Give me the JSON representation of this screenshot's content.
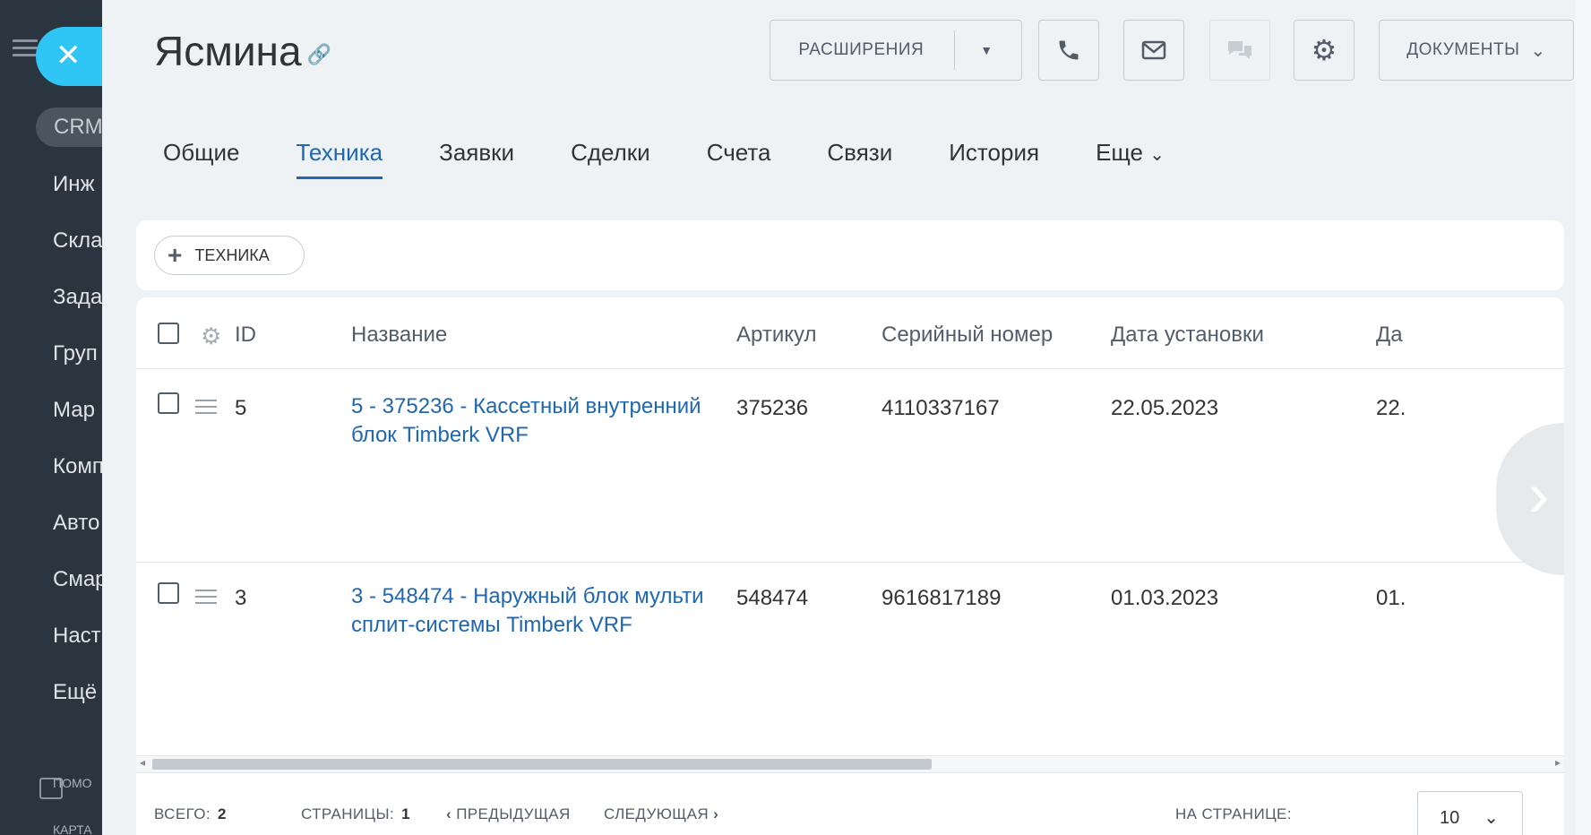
{
  "sidebar": {
    "crm_label": "CRM",
    "items": [
      "Инж",
      "Скла",
      "Зада",
      "Груп",
      "Мар",
      "Комп",
      "Авто",
      "Смар",
      "Наст",
      "Ещё"
    ],
    "help_label": "ПОМО",
    "map_label": "КАРТА"
  },
  "header": {
    "title": "Ясмина",
    "extensions_label": "РАСШИРЕНИЯ",
    "documents_label": "ДОКУМЕНТЫ"
  },
  "tabs": [
    {
      "label": "Общие",
      "active": false
    },
    {
      "label": "Техника",
      "active": true
    },
    {
      "label": "Заявки",
      "active": false
    },
    {
      "label": "Сделки",
      "active": false
    },
    {
      "label": "Счета",
      "active": false
    },
    {
      "label": "Связи",
      "active": false
    },
    {
      "label": "История",
      "active": false
    },
    {
      "label": "Еще",
      "active": false
    }
  ],
  "add_button_label": "ТЕХНИКА",
  "table": {
    "columns": [
      "ID",
      "Название",
      "Артикул",
      "Серийный номер",
      "Дата установки",
      "Да"
    ],
    "rows": [
      {
        "id": "5",
        "name": "5 - 375236 - Кассетный внутренний блок Timberk VRF",
        "article": "375236",
        "serial": "4110337167",
        "install_date": "22.05.2023",
        "extra": "22."
      },
      {
        "id": "3",
        "name": "3 - 548474 - Наружный блок мульти сплит-системы Timberk VRF",
        "article": "548474",
        "serial": "9616817189",
        "install_date": "01.03.2023",
        "extra": "01."
      }
    ]
  },
  "footer": {
    "total_label": "ВСЕГО:",
    "total_value": "2",
    "pages_label": "СТРАНИЦЫ:",
    "pages_value": "1",
    "prev_label": "ПРЕДЫДУЩАЯ",
    "next_label": "СЛЕДУЮЩАЯ",
    "per_page_label": "НА СТРАНИЦЕ:",
    "per_page_value": "10"
  },
  "colors": {
    "accent": "#2067b0",
    "close_button": "#2fc6f6",
    "sidebar": "#2b3540"
  }
}
